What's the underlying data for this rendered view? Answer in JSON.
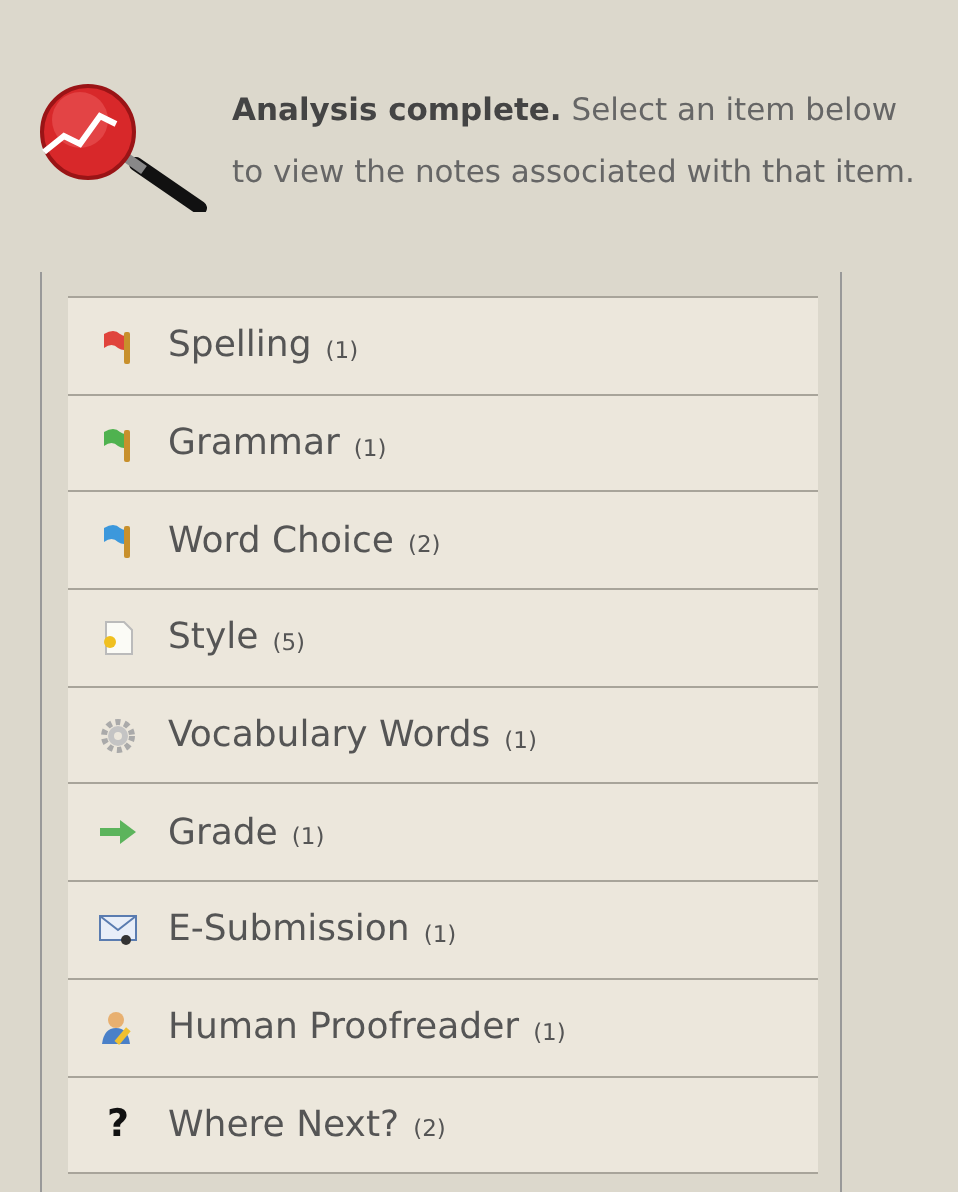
{
  "intro": {
    "text": "**Analysis complete.** Select an item below to view the notes associated with that item."
  },
  "items": [
    {
      "kind": "flag",
      "color": "#e0443c",
      "label": "Spelling",
      "count": "(1)"
    },
    {
      "kind": "flag",
      "color": "#4fb24f",
      "label": "Grammar",
      "count": "(1)"
    },
    {
      "kind": "flag",
      "color": "#3c98dc",
      "label": "Word Choice",
      "count": "(2)"
    },
    {
      "kind": "page",
      "label": "Style",
      "count": "(5)"
    },
    {
      "kind": "gear",
      "label": "Vocabulary Words",
      "count": "(1)"
    },
    {
      "kind": "arrow",
      "label": "Grade",
      "count": "(1)"
    },
    {
      "kind": "mail",
      "label": "E-Submission",
      "count": "(1)"
    },
    {
      "kind": "person",
      "label": "Human Proofreader",
      "count": "(1)"
    },
    {
      "kind": "glyph",
      "glyph": "?",
      "label": "Where Next?",
      "count": "(2)"
    }
  ]
}
